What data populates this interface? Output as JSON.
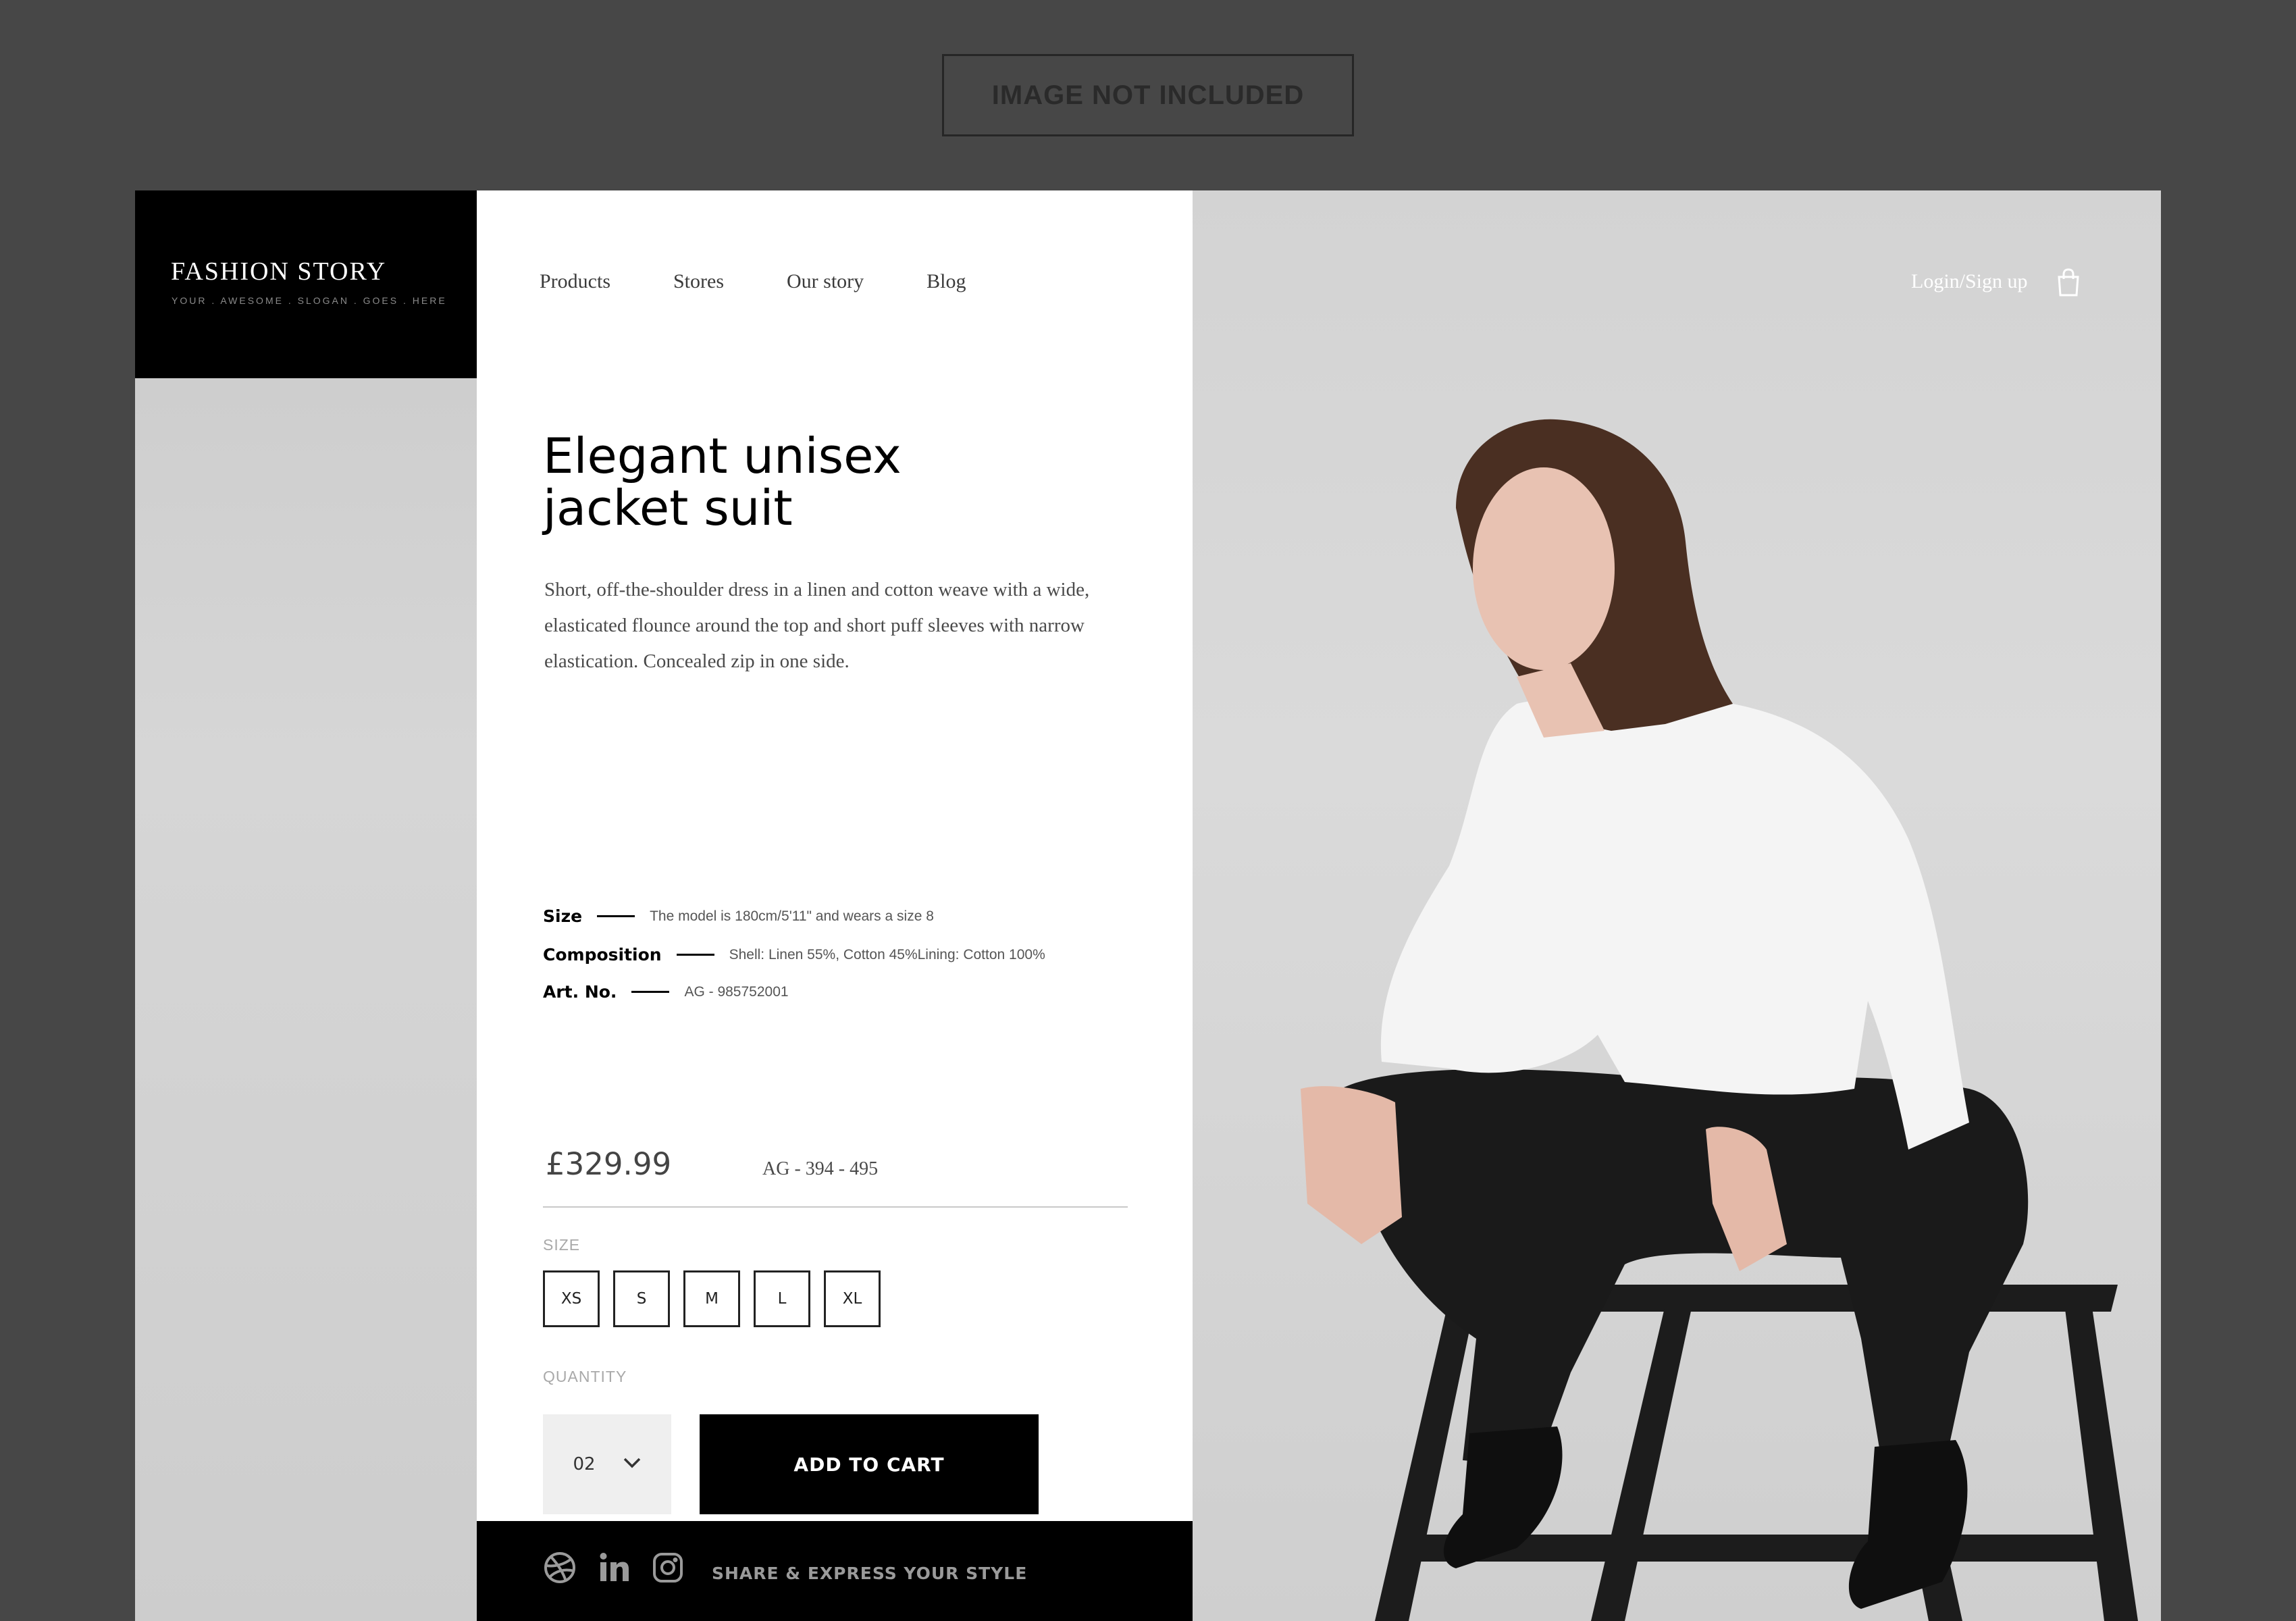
{
  "notice": "IMAGE NOT INCLUDED",
  "brand": {
    "name": "FASHION STORY",
    "slogan": "YOUR . AWESOME . SLOGAN . GOES . HERE"
  },
  "nav": [
    {
      "label": "Products"
    },
    {
      "label": "Stores"
    },
    {
      "label": "Our story"
    },
    {
      "label": "Blog"
    }
  ],
  "header_right": {
    "login": "Login/Sign up",
    "cart_icon": "shopping-bag-icon"
  },
  "product": {
    "title_line1": "Elegant unisex",
    "title_line2": "jacket suit",
    "description": "Short, off-the-shoulder dress in a linen and cotton weave with a wide, elasticated flounce around the top and short puff sleeves with narrow elastication. Concealed zip in one side.",
    "specs": [
      {
        "key": "Size",
        "value": "The model is 180cm/5'11\" and wears a size 8"
      },
      {
        "key": "Composition",
        "value": "Shell: Linen 55%, Cotton 45%Lining: Cotton 100%"
      },
      {
        "key": "Art. No.",
        "value": "AG - 985752001"
      }
    ],
    "price": "£329.99",
    "code": "AG - 394 - 495",
    "size_label": "SIZE",
    "sizes": [
      "XS",
      "S",
      "M",
      "L",
      "XL"
    ],
    "quantity_label": "QUANTITY",
    "quantity": "02",
    "add_to_cart": "ADD TO CART"
  },
  "footer": {
    "icons": [
      "dribbble-icon",
      "linkedin-icon",
      "instagram-icon"
    ],
    "tagline": "SHARE & EXPRESS YOUR STYLE"
  },
  "colors": {
    "background": "#474747",
    "panel": "#ffffff",
    "accent": "#000000"
  }
}
